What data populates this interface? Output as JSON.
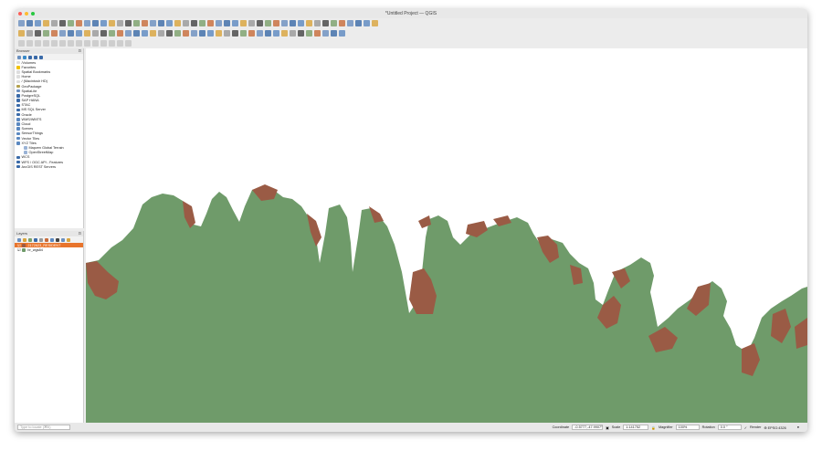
{
  "window": {
    "title": "*Untitled Project — QGIS"
  },
  "browser": {
    "title": "Browser",
    "items": [
      {
        "label": "/Volumes",
        "color": "#ddd"
      },
      {
        "label": "Favorites",
        "color": "#f2c200"
      },
      {
        "label": "Spatial Bookmarks",
        "color": "#ddd"
      },
      {
        "label": "Home",
        "color": "#ddd"
      },
      {
        "label": "/ (Macintosh HD)",
        "color": "#ddd"
      },
      {
        "label": "GeoPackage",
        "color": "#b3a04b"
      },
      {
        "label": "SpatiaLite",
        "color": "#6a8fbf"
      },
      {
        "label": "PostgreSQL",
        "color": "#3a6aa8"
      },
      {
        "label": "SAP HANA",
        "color": "#3a6aa8"
      },
      {
        "label": "STAC",
        "color": "#3a6aa8"
      },
      {
        "label": "MS SQL Server",
        "color": "#3a6aa8"
      },
      {
        "label": "Oracle",
        "color": "#3a6aa8"
      },
      {
        "label": "WMS/WMTS",
        "color": "#5b88c0"
      },
      {
        "label": "Cloud",
        "color": "#5b88c0"
      },
      {
        "label": "Scenes",
        "color": "#5b88c0"
      },
      {
        "label": "SensorThings",
        "color": "#5b88c0"
      },
      {
        "label": "Vector Tiles",
        "color": "#5b88c0"
      },
      {
        "label": "XYZ Tiles",
        "color": "#5b88c0"
      },
      {
        "label": "Mapzen Global Terrain",
        "color": "#9ab3d6",
        "indent": true
      },
      {
        "label": "OpenStreetMap",
        "color": "#9ab3d6",
        "indent": true
      },
      {
        "label": "WCS",
        "color": "#3a6aa8"
      },
      {
        "label": "WFS / OGC API - Features",
        "color": "#3a6aa8"
      },
      {
        "label": "ArcGIS REST Servers",
        "color": "#3a6aa8"
      }
    ]
  },
  "layers": {
    "title": "Layers",
    "items": [
      {
        "label": "2172623_RESIDENT",
        "color": "#9a5b45",
        "selected": true
      },
      {
        "label": "br_wgs84",
        "color": "#6f9b6a",
        "selected": false
      }
    ]
  },
  "status": {
    "search_placeholder": "Type to locate (⌘K)",
    "coordinate_label": "Coordinate",
    "coordinate": "-0.5777,-47.9907°",
    "scale_label": "Scale",
    "scale": "1:141752",
    "magnifier_label": "Magnifier",
    "magnifier": "100%",
    "rotation_label": "Rotation",
    "rotation": "0.0 °",
    "render_label": "Render",
    "crs": "EPSG:4326"
  },
  "colors": {
    "land": "#6f9b6a",
    "mangrove": "#9a5b45",
    "selected": "#e8742c"
  }
}
